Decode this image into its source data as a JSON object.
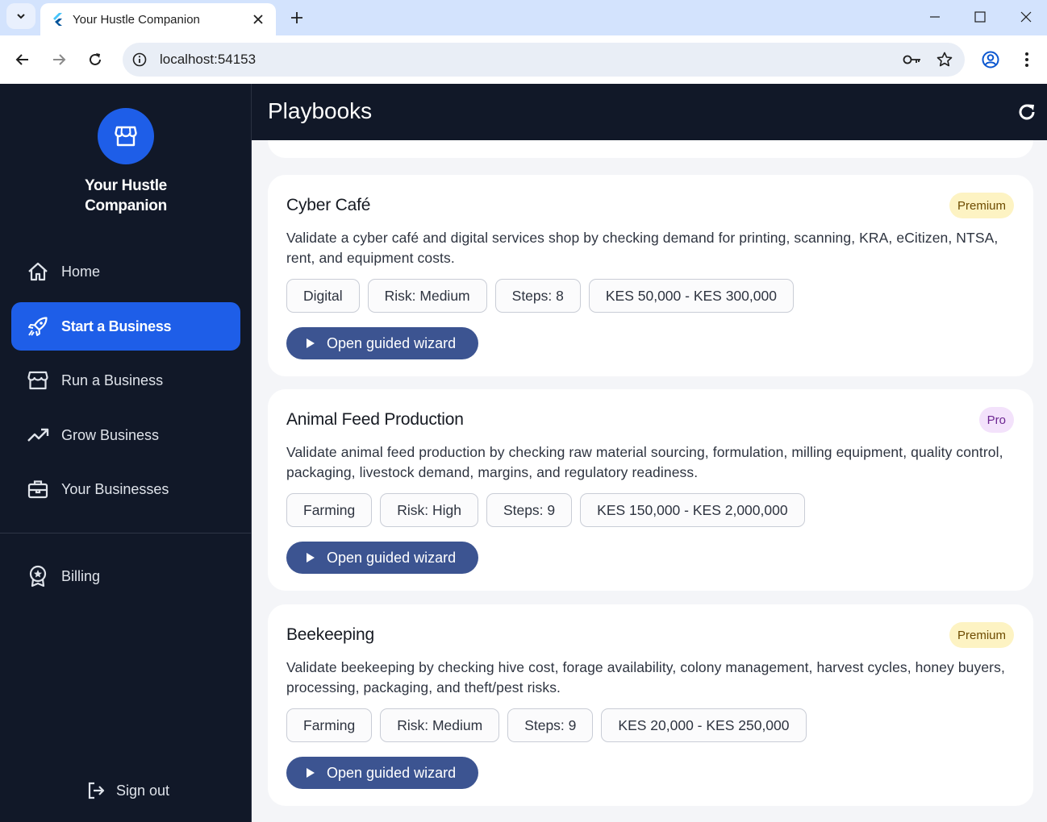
{
  "browser": {
    "tab_title": "Your Hustle Companion",
    "url": "localhost:54153"
  },
  "sidebar": {
    "brand_line1": "Your Hustle",
    "brand_line2": "Companion",
    "items": [
      {
        "label": "Home",
        "icon": "home-icon"
      },
      {
        "label": "Start a Business",
        "icon": "rocket-icon",
        "active": true
      },
      {
        "label": "Run a Business",
        "icon": "storefront-icon"
      },
      {
        "label": "Grow Business",
        "icon": "trending-up-icon"
      },
      {
        "label": "Your Businesses",
        "icon": "briefcase-icon"
      },
      {
        "label": "Billing",
        "icon": "badge-icon"
      }
    ],
    "signout_label": "Sign out"
  },
  "header": {
    "title": "Playbooks"
  },
  "playbooks": [
    {
      "title": "Cyber Café",
      "tier": "Premium",
      "description": "Validate a cyber café and digital services shop by checking demand for printing, scanning, KRA, eCitizen, NTSA, rent, and equipment costs.",
      "chips": [
        "Digital",
        "Risk: Medium",
        "Steps: 8",
        "KES 50,000 - KES 300,000"
      ],
      "button_label": "Open guided wizard"
    },
    {
      "title": "Animal Feed Production",
      "tier": "Pro",
      "description": "Validate animal feed production by checking raw material sourcing, formulation, milling equipment, quality control, packaging, livestock demand, margins, and regulatory readiness.",
      "chips": [
        "Farming",
        "Risk: High",
        "Steps: 9",
        "KES 150,000 - KES 2,000,000"
      ],
      "button_label": "Open guided wizard"
    },
    {
      "title": "Beekeeping",
      "tier": "Premium",
      "description": "Validate beekeeping by checking hive cost, forage availability, colony management, harvest cycles, honey buyers, processing, packaging, and theft/pest risks.",
      "chips": [
        "Farming",
        "Risk: Medium",
        "Steps: 9",
        "KES 20,000 - KES 250,000"
      ],
      "button_label": "Open guided wizard"
    }
  ],
  "colors": {
    "sidebar_bg": "#111828",
    "accent": "#1e5ee8",
    "wizard_button": "#3c5491",
    "premium_bg": "#fdf3c3",
    "pro_bg": "#f3e2fb"
  }
}
